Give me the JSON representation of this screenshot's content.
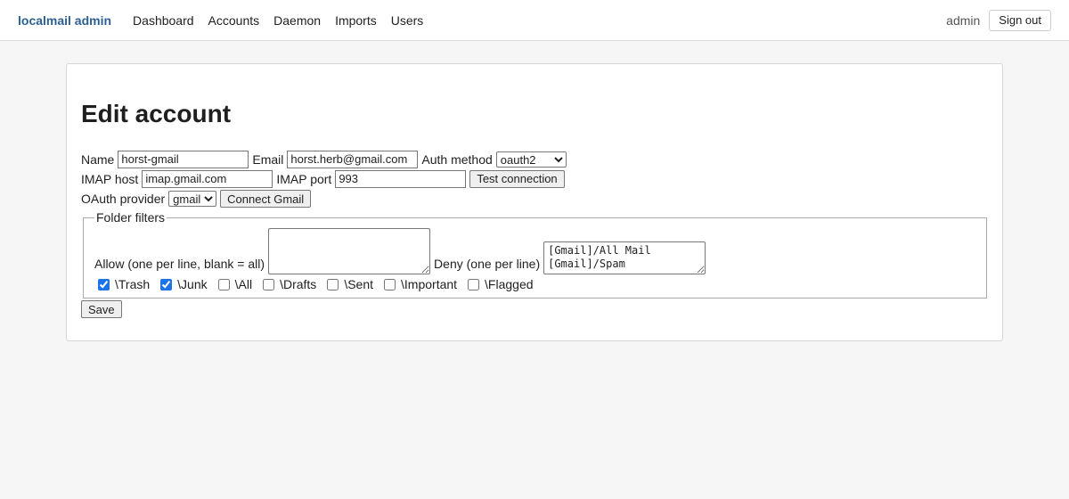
{
  "header": {
    "brand": "localmail admin",
    "nav": [
      "Dashboard",
      "Accounts",
      "Daemon",
      "Imports",
      "Users"
    ],
    "user": "admin",
    "signout_label": "Sign out"
  },
  "form": {
    "title": "Edit account",
    "name_label": "Name",
    "name_value": "horst-gmail",
    "email_label": "Email",
    "email_value": "horst.herb@gmail.com",
    "auth_label": "Auth method",
    "auth_value": "oauth2",
    "imap_host_label": "IMAP host",
    "imap_host_value": "imap.gmail.com",
    "imap_port_label": "IMAP port",
    "imap_port_value": "993",
    "test_label": "Test connection",
    "oauth_label": "OAuth provider",
    "oauth_value": "gmail",
    "connect_label": "Connect Gmail",
    "filters": {
      "legend": "Folder filters",
      "allow_label": "Allow (one per line, blank = all)",
      "allow_value": "",
      "deny_label": "Deny (one per line)",
      "deny_value": "[Gmail]/All Mail\n[Gmail]/Spam",
      "checks": [
        {
          "label": "\\Trash",
          "checked": true
        },
        {
          "label": "\\Junk",
          "checked": true
        },
        {
          "label": "\\All",
          "checked": false
        },
        {
          "label": "\\Drafts",
          "checked": false
        },
        {
          "label": "\\Sent",
          "checked": false
        },
        {
          "label": "\\Important",
          "checked": false
        },
        {
          "label": "\\Flagged",
          "checked": false
        }
      ]
    },
    "save_label": "Save"
  }
}
